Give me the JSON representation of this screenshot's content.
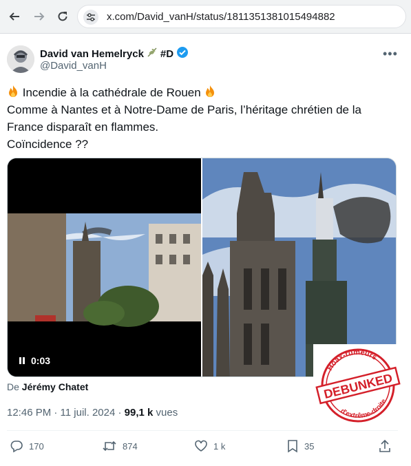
{
  "browser": {
    "url": "x.com/David_vanH/status/1811351381015494882"
  },
  "tweet": {
    "author_name": "David van Hemelryck",
    "author_tag": "#D",
    "handle": "@David_vanH",
    "text_line1": "Incendie à la cathédrale de Rouen",
    "text_line2": "Comme à Nantes et à Notre-Dame de Paris, l’héritage chrétien de la",
    "text_line3": "France disparaît en flammes.",
    "text_line4": "Coïncidence ??",
    "video_time": "0:03",
    "credit_prefix": "De",
    "credit_name": "Jérémy Chatet",
    "time": "12:46 PM · 11 juil. 2024 ·",
    "views_count": "99,1 k",
    "views_label": "vues",
    "replies": "170",
    "reposts": "874",
    "likes": "1 k",
    "bookmarks": "35"
  },
  "stamp": {
    "top_text": "Hoax-rumeurs",
    "center_text": "DEBUNKED",
    "bottom_text": "d'extrême-droite"
  },
  "colors": {
    "verified": "#1d9bf0",
    "stamp_red": "#d4202a",
    "secondary_text": "#536471"
  }
}
